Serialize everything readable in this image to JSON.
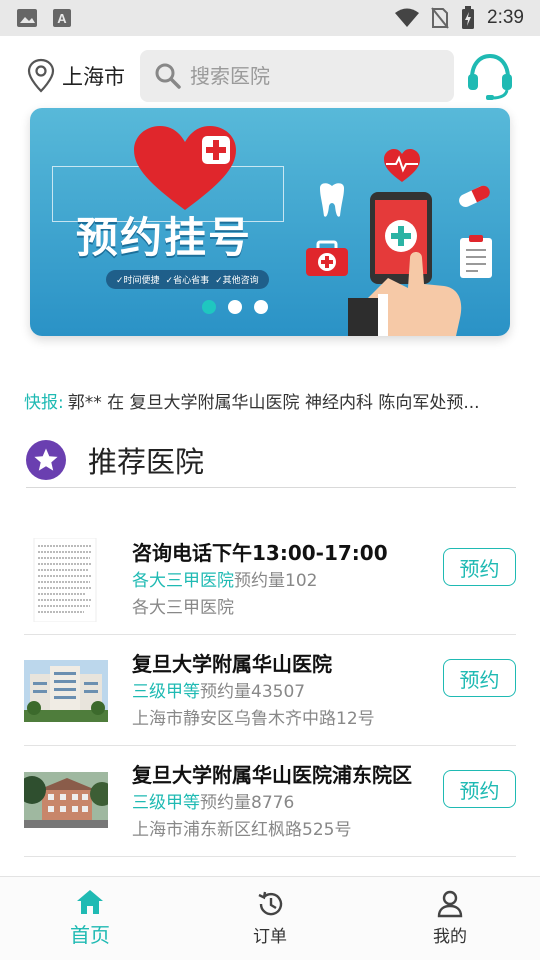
{
  "status_bar": {
    "time": "2:39"
  },
  "header": {
    "city": "上海市",
    "search_placeholder": "搜索医院"
  },
  "banner": {
    "title": "预约挂号",
    "tags": [
      "✓时间便捷",
      "✓省心省事",
      "✓其他咨询"
    ],
    "slide_count": 3,
    "active_slide": 0
  },
  "ticker": {
    "label": "快报:",
    "text": "郭** 在 复旦大学附属华山医院 神经内科 陈向军处预..."
  },
  "section": {
    "title": "推荐医院"
  },
  "hospitals": [
    {
      "name": "咨询电话下午13:00-17:00",
      "level": "各大三甲医院",
      "booking_label": "预约量",
      "booking_count": "102",
      "address": "各大三甲医院",
      "button": "预约"
    },
    {
      "name": "复旦大学附属华山医院",
      "level": "三级甲等",
      "booking_label": "预约量",
      "booking_count": "43507",
      "address": "上海市静安区乌鲁木齐中路12号",
      "button": "预约"
    },
    {
      "name": "复旦大学附属华山医院浦东院区",
      "level": "三级甲等",
      "booking_label": "预约量",
      "booking_count": "8776",
      "address": " 上海市浦东新区红枫路525号",
      "button": "预约"
    }
  ],
  "bottom_nav": [
    {
      "label": "首页",
      "icon": "home-icon",
      "active": true
    },
    {
      "label": "订单",
      "icon": "history-icon",
      "active": false
    },
    {
      "label": "我的",
      "icon": "person-icon",
      "active": false
    }
  ],
  "colors": {
    "accent": "#1fbab3",
    "star_badge": "#6a3fb0",
    "banner": "#2a92c6"
  }
}
